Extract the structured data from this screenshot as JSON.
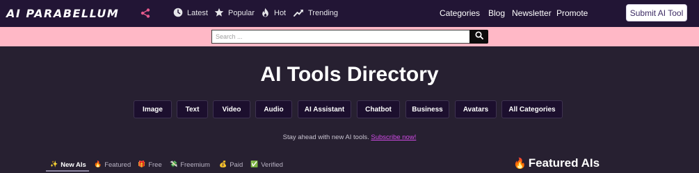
{
  "brand": {
    "logo_text": "AI PARABELLUM"
  },
  "nav": {
    "links": [
      {
        "label": "Latest",
        "icon": "clock-icon"
      },
      {
        "label": "Popular",
        "icon": "star-icon"
      },
      {
        "label": "Hot",
        "icon": "flame-icon"
      },
      {
        "label": "Trending",
        "icon": "trending-up-icon"
      }
    ],
    "right_links": [
      "Categories",
      "Blog",
      "Newsletter",
      "Promote"
    ],
    "submit_label": "Submit AI Tool"
  },
  "search": {
    "placeholder": "Search ...",
    "value": ""
  },
  "main": {
    "title": "AI Tools Directory",
    "categories": [
      "Image",
      "Text",
      "Video",
      "Audio",
      "AI Assistant",
      "Chatbot",
      "Business",
      "Avatars",
      "All Categories"
    ],
    "tagline": "Stay ahead with new AI tools.",
    "subscribe_label": "Subscribe now!"
  },
  "filters": {
    "tabs": [
      {
        "label": "New AIs",
        "emoji": "✨",
        "active": true
      },
      {
        "label": "Featured",
        "emoji": "🔥",
        "active": false
      },
      {
        "label": "Free",
        "emoji": "🎁",
        "active": false
      },
      {
        "label": "Freemium",
        "emoji": "💸",
        "active": false
      },
      {
        "label": "Paid",
        "emoji": "💰",
        "active": false
      },
      {
        "label": "Verified",
        "emoji": "✅",
        "active": false
      }
    ]
  },
  "featured": {
    "emoji": "🔥",
    "title": "Featured AIs"
  },
  "colors": {
    "nav_bg": "#221535",
    "page_bg": "#272031",
    "search_band": "#ffb8c6",
    "accent_link": "#d14be6",
    "share_icon": "#e65a8c"
  }
}
